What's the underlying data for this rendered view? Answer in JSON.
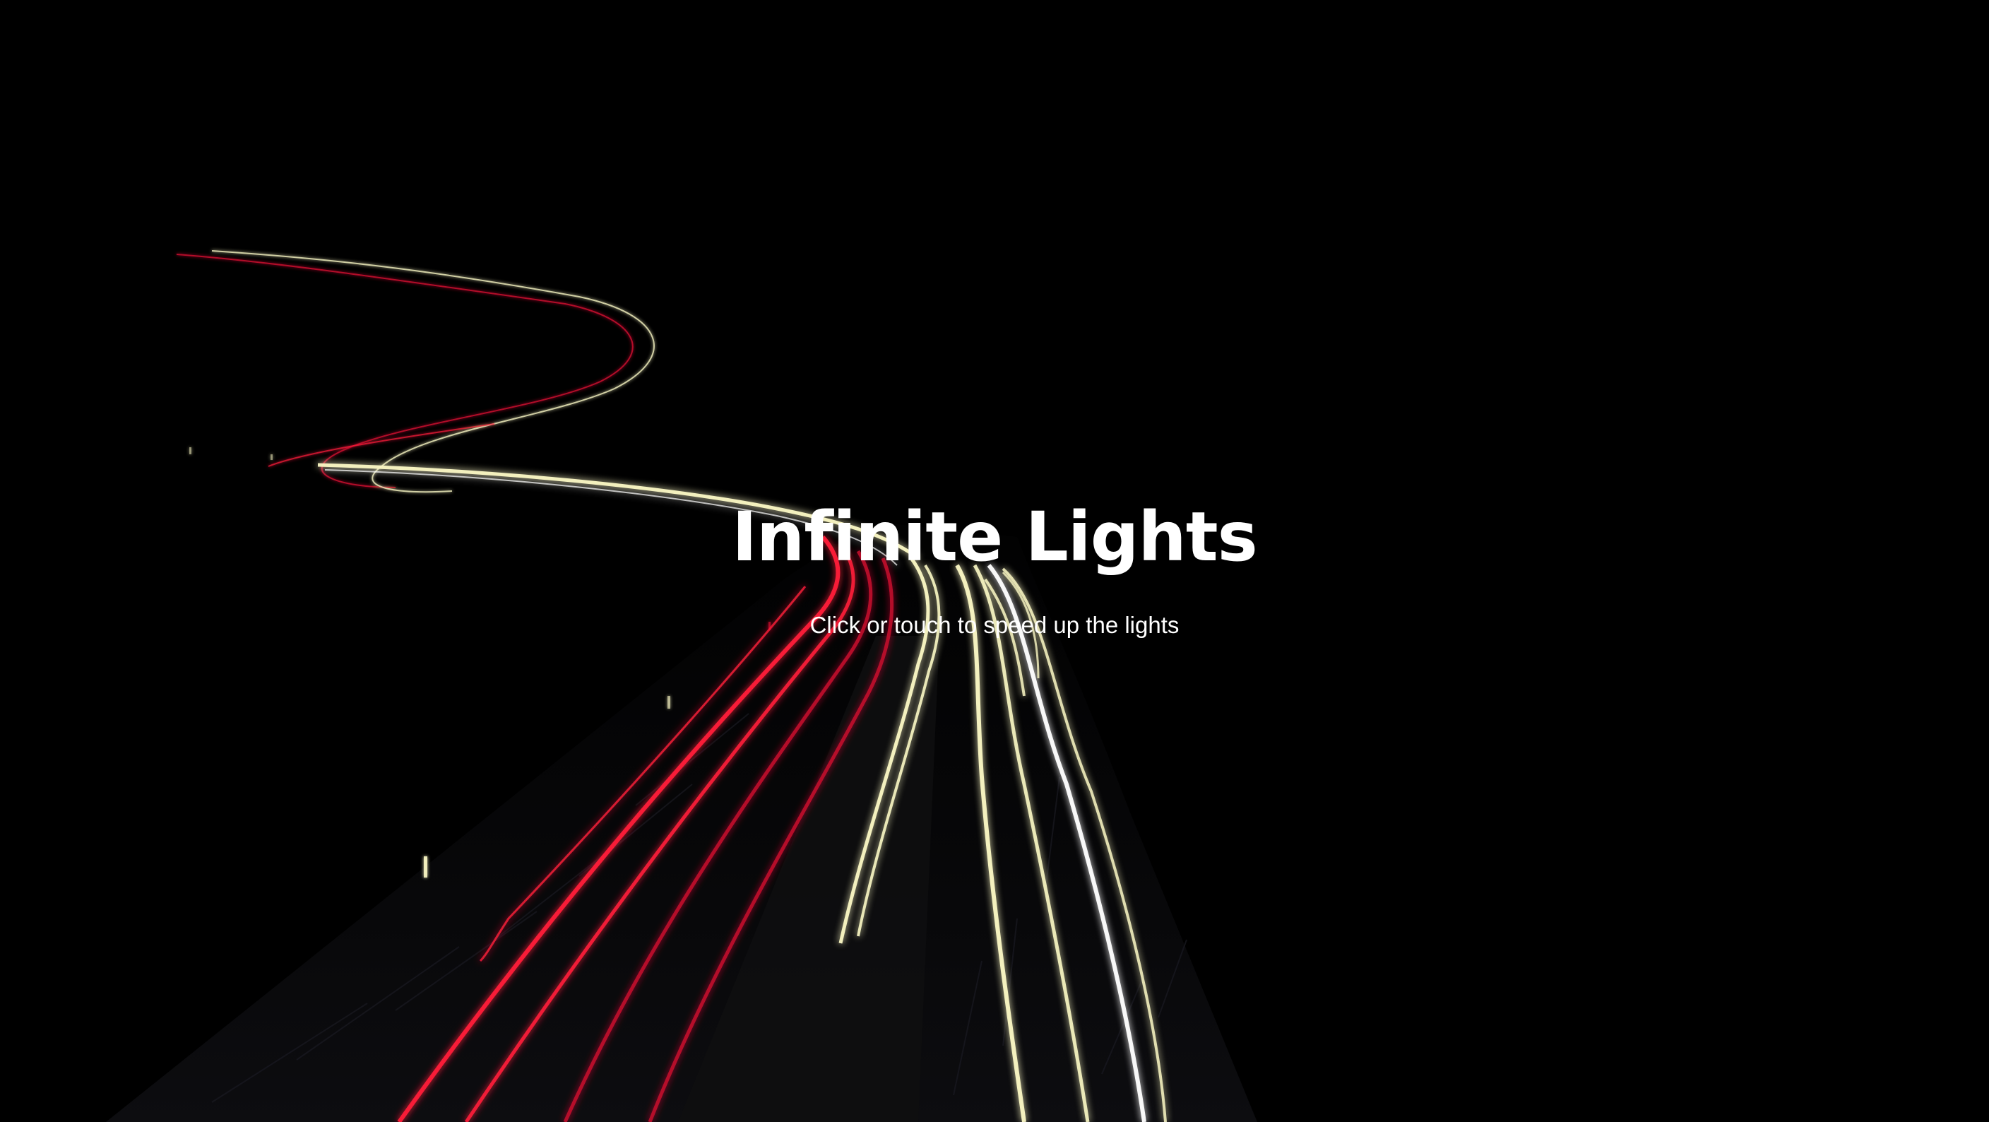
{
  "page": {
    "title": "Infinite Lights",
    "subtitle": "Click or touch to speed up the lights"
  },
  "colors": {
    "background": "#000000",
    "road": "#0b0b0d",
    "road_edge": "#15151a",
    "tail_lights": "#ff1c3a",
    "tail_lights_dim": "#c8102e",
    "head_lights": "#fbf8c4",
    "head_lights_bright": "#ffffff",
    "text": "#ffffff"
  }
}
